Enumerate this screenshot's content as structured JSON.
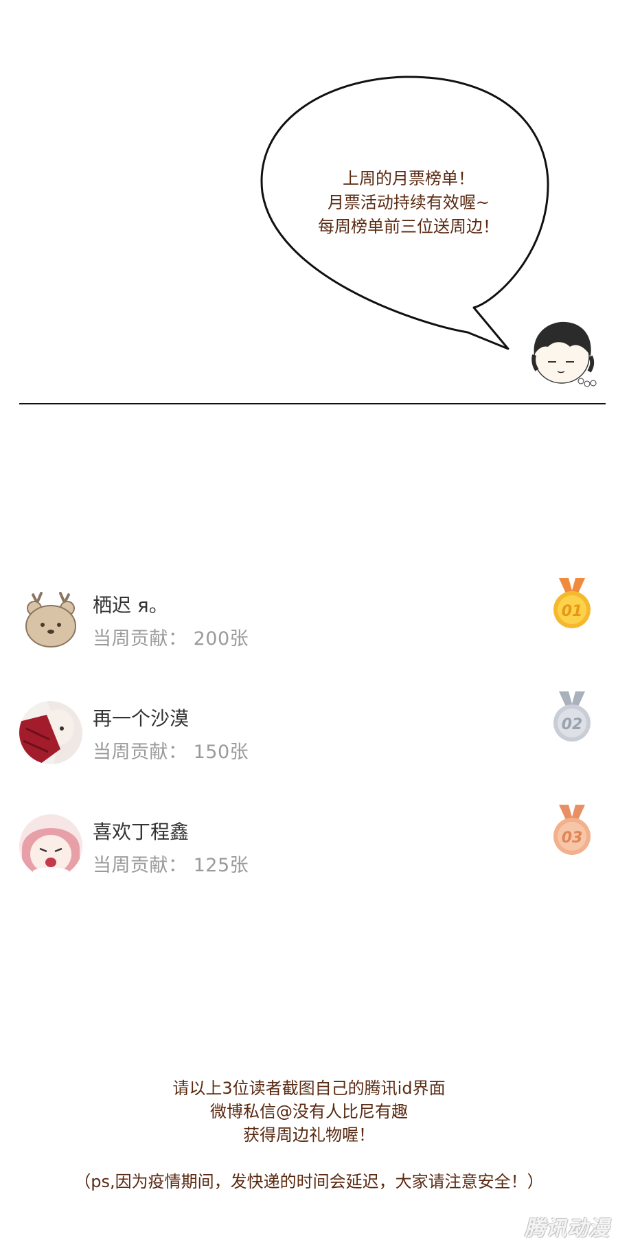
{
  "bubble": {
    "lines": [
      "上周的月票榜单！",
      "月票活动持续有效喔~",
      "每周榜单前三位送周边！"
    ]
  },
  "ranking": [
    {
      "name": "栖迟 я。",
      "label": "当周贡献：",
      "value": "200张",
      "medal": "01",
      "medal_color": "#f5b82e",
      "ribbon_color": "#f08a3c"
    },
    {
      "name": "再一个沙漠",
      "label": "当周贡献：",
      "value": "150张",
      "medal": "02",
      "medal_color": "#c9ced6",
      "ribbon_color": "#aab1bb"
    },
    {
      "name": "喜欢丁程鑫",
      "label": "当周贡献：",
      "value": "125张",
      "medal": "03",
      "medal_color": "#f2b08c",
      "ribbon_color": "#e88f64"
    }
  ],
  "footer": {
    "lines": [
      "请以上3位读者截图自己的腾讯id界面",
      "微博私信@没有人比尼有趣",
      "获得周边礼物喔！"
    ],
    "note": "（ps,因为疫情期间，发快递的时间会延迟，大家请注意安全！）"
  },
  "watermark": "腾讯动漫",
  "colors": {
    "text_brown": "#5a2a12",
    "gray": "#9a9a9a"
  }
}
